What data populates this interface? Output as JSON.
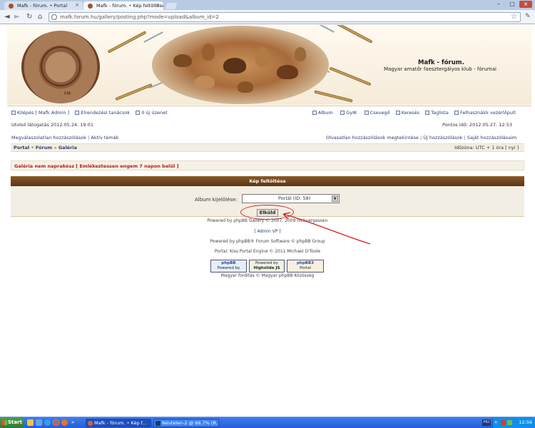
{
  "browser": {
    "tabs": [
      {
        "label": "Mafk - fórum. • Portal"
      },
      {
        "label": "Mafk - fórum. • Kép feltöltése"
      }
    ],
    "url": "mafk.forum.hu/gallery/posting.php?mode=upload&album_id=2"
  },
  "header": {
    "site_title": "Mafk - fórum.",
    "site_subtitle": "Magyar amatőr faesztergályos klub - fórumai",
    "logo_text": "FM"
  },
  "top_links": {
    "left": [
      {
        "label": "Kilépés [ Mafk Admin ]",
        "icon": "logout-icon"
      },
      {
        "label": "Elrendezési tanácsok",
        "icon": "plus-icon"
      },
      {
        "label": "0 új üzenet",
        "icon": "message-icon"
      }
    ],
    "right": [
      {
        "label": "Album",
        "icon": "album-icon"
      },
      {
        "label": "GyIK",
        "icon": "faq-icon"
      },
      {
        "label": "Csevegő",
        "icon": "chat-icon"
      },
      {
        "label": "Keresés",
        "icon": "search-icon"
      },
      {
        "label": "Taglista",
        "icon": "members-icon"
      },
      {
        "label": "Felhasználói vezérlőpult",
        "icon": "control-panel-icon"
      }
    ]
  },
  "last_visit": "Utolsó látogatás 2012.05.24. 19:01",
  "current_time": "Pontos idő: 2012.05.27. 12:53",
  "search_links": {
    "left": [
      "Megválaszolatlan hozzászólások",
      "Aktív témák"
    ],
    "right": [
      "Olvasatlan hozzászólások megtekintése",
      "Új hozzászólások",
      "Saját hozzászólásaim"
    ]
  },
  "breadcrumb": {
    "items": [
      "Portal",
      "Fórum",
      "Galéria"
    ],
    "timezone": "Időzóna: UTC + 1 óra",
    "dst": "[ nyi ]"
  },
  "notice": {
    "text": "Galéria nem naprakész",
    "link": "[ Emlékeztessen engem 7 napon belül ]"
  },
  "upload": {
    "title": "Kép feltöltése",
    "album_label": "Album kijelölése:",
    "album_selected": "Portál (ID: 58)",
    "submit_label": "Elküld"
  },
  "footer": {
    "gallery": "Powered by phpBB Gallery © 2007, 2009 nickvergessen",
    "admin": "[ Admin VP ]",
    "phpbb": "Powered by phpBB® Forum Software © phpBB Group",
    "portal": "Portal: Kiss Portal Engine © 2011 Michael O'Toole",
    "translation": "Magyar fordítás © Magyar phpBB Közösség",
    "badges": [
      {
        "line1": "phpBB",
        "line2": "Powered by"
      },
      {
        "line1": "Powered by",
        "line2": "Highslide JS"
      },
      {
        "line1": "phpBB3",
        "line2": "Portal"
      }
    ]
  },
  "taskbar": {
    "start": "Start",
    "buttons": [
      {
        "label": "Mafk - fórum. • Kép f..."
      },
      {
        "label": "Névtelen-2 @ 66,7% (R..."
      }
    ],
    "tray_lang": "HU",
    "clock": "12:56"
  },
  "colors": {
    "header_bar": "#6b3f1a",
    "annotation": "#d42020",
    "link": "#2a3d6b",
    "notice": "#b0201a"
  }
}
